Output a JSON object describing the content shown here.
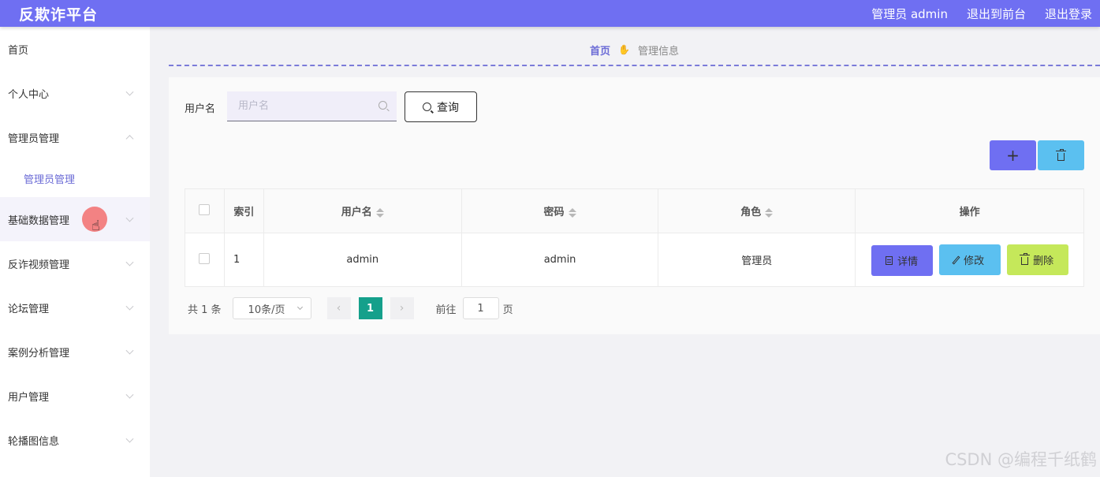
{
  "header": {
    "brand": "反欺诈平台",
    "user": "管理员 admin",
    "to_front": "退出到前台",
    "logout": "退出登录"
  },
  "sidebar": {
    "items": [
      {
        "label": "首页"
      },
      {
        "label": "个人中心"
      },
      {
        "label": "管理员管理"
      },
      {
        "label": "管理员管理"
      },
      {
        "label": "基础数据管理"
      },
      {
        "label": "反诈视频管理"
      },
      {
        "label": "论坛管理"
      },
      {
        "label": "案例分析管理"
      },
      {
        "label": "用户管理"
      },
      {
        "label": "轮播图信息"
      }
    ]
  },
  "breadcrumb": {
    "home": "首页",
    "current": "管理信息"
  },
  "search": {
    "label": "用户名",
    "placeholder": "用户名",
    "button": "查询"
  },
  "toolbar": {
    "add": "+"
  },
  "table": {
    "headers": [
      "索引",
      "用户名",
      "密码",
      "角色",
      "操作"
    ],
    "rows": [
      {
        "index": "1",
        "username": "admin",
        "password": "admin",
        "role": "管理员"
      }
    ],
    "actions": {
      "detail": "详情",
      "edit": "修改",
      "delete": "删除"
    }
  },
  "pagination": {
    "total": "共 1 条",
    "page_size": "10条/页",
    "prev": "‹",
    "current": "1",
    "next": "›",
    "goto_label": "前往",
    "goto_value": "1",
    "goto_suffix": "页"
  },
  "watermark": "CSDN @编程千纸鹤"
}
